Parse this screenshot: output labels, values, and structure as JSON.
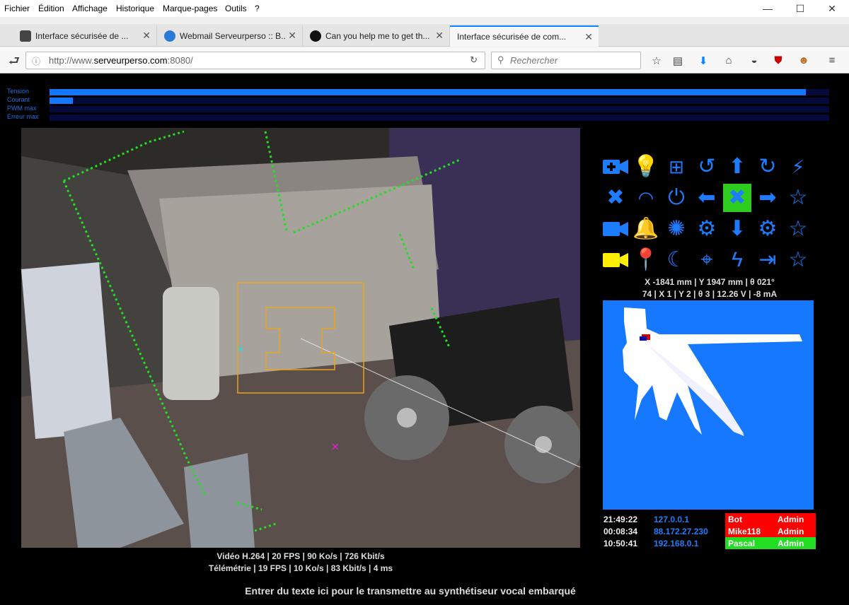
{
  "menu": [
    "Fichier",
    "Édition",
    "Affichage",
    "Historique",
    "Marque-pages",
    "Outils",
    "?"
  ],
  "tabs": [
    {
      "title": "Interface sécurisée de ...",
      "favicon_color": "#444444"
    },
    {
      "title": "Webmail Serveurperso :: B...",
      "favicon_color": "#2a7ad6"
    },
    {
      "title": "Can you help me to get th...",
      "favicon_color": "#111111"
    },
    {
      "title": "Interface sécurisée de com...",
      "favicon_color": "#f7f7f7"
    }
  ],
  "url": {
    "prefix": "http://www.",
    "host": "serveurperso.com",
    "suffix": ":8080/"
  },
  "search_placeholder": "Rechercher",
  "gauges": [
    {
      "label": "Tension",
      "level": 0.97
    },
    {
      "label": "Courant",
      "level": 0.03
    },
    {
      "label": "PWM max",
      "level": 0
    },
    {
      "label": "Erreur max",
      "level": 0
    }
  ],
  "video_stats": {
    "line1": "Vidéo H.264 | 20 FPS | 90 Ko/s | 726 Kbit/s",
    "line2": "Télémétrie | 19 FPS | 10 Ko/s | 83 Kbit/s | 4 ms"
  },
  "controls": [
    [
      "video-add-icon",
      "lightbulb-icon",
      "network-icon",
      "rotate-left-icon",
      "arrow-up-icon",
      "rotate-right-icon",
      "plug-icon"
    ],
    [
      "close-icon",
      "wifi-icon",
      "power-icon",
      "arrow-left-icon",
      "stop-icon",
      "arrow-right-icon",
      "star-icon"
    ],
    [
      "video-icon",
      "alarm-icon",
      "laser-icon",
      "gear-icon",
      "arrow-down-icon",
      "gear-icon",
      "star-icon"
    ],
    [
      "camera-active-icon",
      "location-icon",
      "sleep-icon",
      "target-icon",
      "lightning-icon",
      "exit-icon",
      "star-icon"
    ]
  ],
  "position": {
    "line1": "X -1841 mm | Y 1947 mm | θ 021°",
    "line2": "74 | X 1 | Y 2 | θ 3 | 12.26 V | -8 mA"
  },
  "users": [
    {
      "time": "21:49:22",
      "ip": "127.0.0.1",
      "name": "Bot",
      "role": "Admin",
      "color": "#ff0000"
    },
    {
      "time": "00:08:34",
      "ip": "88.172.27.230",
      "name": "Mike118",
      "role": "Admin",
      "color": "#ff0000"
    },
    {
      "time": "10:50:41",
      "ip": "192.168.0.1",
      "name": "Pascal",
      "role": "Admin",
      "color": "#22dd22"
    }
  ],
  "tts_prompt": "Entrer du texte ici pour le transmettre au synthétiseur vocal embarqué"
}
